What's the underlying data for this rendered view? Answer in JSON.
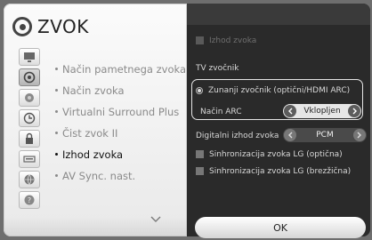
{
  "header": {
    "title": "ZVOK",
    "icon": "speaker-icon"
  },
  "sidebar": {
    "icons": [
      "tv-icon",
      "speaker-icon",
      "channel-icon",
      "clock-icon",
      "lock-icon",
      "keyboard-icon",
      "network-icon",
      "help-icon"
    ],
    "active_icon_index": 1
  },
  "menu": {
    "items": [
      {
        "label": "Način pametnega zvoka"
      },
      {
        "label": "Način zvoka"
      },
      {
        "label": "Virtualni Surround Plus"
      },
      {
        "label": "Čist zvok II"
      },
      {
        "label": "Izhod zvoka"
      },
      {
        "label": "AV Sync. nast."
      }
    ],
    "selected_index": 4
  },
  "right": {
    "top_checkbox_label": "Izhod zvoka",
    "tv_speaker_label": "TV zvočnik",
    "external_speaker_label": "Zunanji zvočnik (optični/HDMI ARC)",
    "arc_label": "Način ARC",
    "arc_value": "Vklopljen",
    "digital_output_label": "Digitalni izhod zvoka",
    "digital_output_value": "PCM",
    "sync_optical_label": "Sinhronizacija zvoka LG (optična)",
    "sync_wireless_label": "Sinhronizacija zvoka LG (brezžična)"
  },
  "ok_label": "OK",
  "colors": {
    "panel_dark": "#2a2a2a",
    "panel_light": "#f2f2f2",
    "accent_text": "#111111"
  }
}
